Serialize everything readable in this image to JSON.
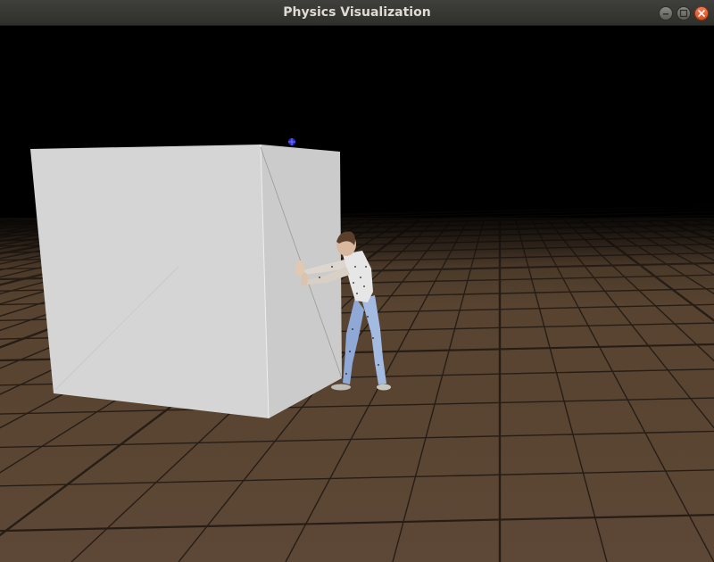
{
  "window": {
    "title": "Physics Visualization",
    "controls": {
      "minimize_icon": "minimize-icon",
      "maximize_icon": "maximize-icon",
      "close_icon": "close-icon"
    }
  },
  "scene": {
    "background_color": "#000000",
    "ground_color": "#5a4536",
    "grid_line_color": "#2b2119",
    "box_color": "#d3d3d3",
    "character_shirt_color": "#e8e8e8",
    "character_pants_color": "#8ea9d6",
    "marker_color": "#3a3ae0"
  }
}
